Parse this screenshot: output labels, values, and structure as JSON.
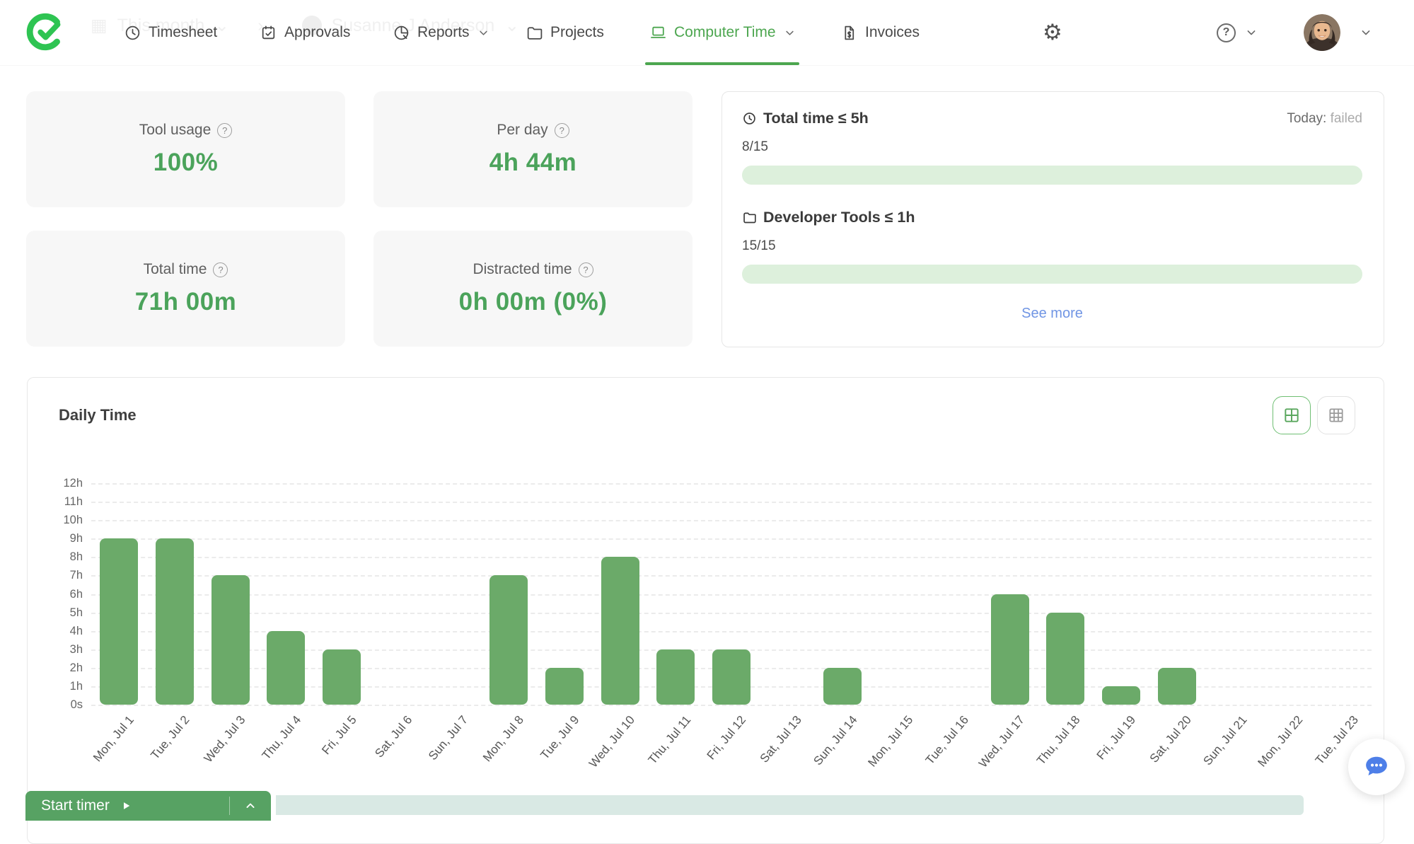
{
  "nav": {
    "logo_icon": "brand-check-logo-icon",
    "items": [
      {
        "label": "Timesheet",
        "icon": "clock-icon"
      },
      {
        "label": "Approvals",
        "icon": "calendar-check-icon"
      },
      {
        "label": "Reports",
        "icon": "pie-chart-icon",
        "chevron": true
      },
      {
        "label": "Projects",
        "icon": "folder-icon"
      },
      {
        "label": "Computer Time",
        "icon": "laptop-icon",
        "chevron": true,
        "active": true
      },
      {
        "label": "Invoices",
        "icon": "invoice-icon"
      }
    ],
    "gear_icon": "settings-gear-icon",
    "help_glyph": "?"
  },
  "ghost_header": {
    "period": "This month",
    "separator": "›",
    "user": "Susanne J Anderson"
  },
  "stats": [
    {
      "title": "Tool usage",
      "value": "100%",
      "help_glyph": "?"
    },
    {
      "title": "Per day",
      "value": "4h 44m",
      "help_glyph": "?"
    },
    {
      "title": "Total time",
      "value": "71h 00m",
      "help_glyph": "?"
    },
    {
      "title": "Distracted time",
      "value": "0h 00m (0%)",
      "help_glyph": "?"
    }
  ],
  "goals": {
    "items": [
      {
        "icon": "clock-icon",
        "title": "Total time ≤ 5h",
        "count": "8/15",
        "status_label": "Today:",
        "status_value": "failed",
        "progress_percent": 100
      },
      {
        "icon": "folder-icon",
        "title": "Developer Tools ≤ 1h",
        "count": "15/15",
        "progress_percent": 100
      }
    ],
    "see_more_label": "See more"
  },
  "chart_data": {
    "type": "bar",
    "title": "Daily Time",
    "categories": [
      "Mon, Jul 1",
      "Tue, Jul 2",
      "Wed, Jul 3",
      "Thu, Jul 4",
      "Fri, Jul 5",
      "Sat, Jul 6",
      "Sun, Jul 7",
      "Mon, Jul 8",
      "Tue, Jul 9",
      "Wed, Jul 10",
      "Thu, Jul 11",
      "Fri, Jul 12",
      "Sat, Jul 13",
      "Sun, Jul 14",
      "Mon, Jul 15",
      "Tue, Jul 16",
      "Wed, Jul 17",
      "Thu, Jul 18",
      "Fri, Jul 19",
      "Sat, Jul 20",
      "Sun, Jul 21",
      "Mon, Jul 22",
      "Tue, Jul 23"
    ],
    "values": [
      9,
      9,
      7,
      4,
      3,
      0,
      0,
      7,
      2,
      8,
      3,
      3,
      0,
      2,
      0,
      0,
      6,
      5,
      1,
      2,
      0,
      0,
      0
    ],
    "unit": "hours",
    "xlabel": "",
    "ylabel": "",
    "ylim": [
      0,
      12
    ],
    "ytick_labels": [
      "0s",
      "1h",
      "2h",
      "3h",
      "4h",
      "5h",
      "6h",
      "7h",
      "8h",
      "9h",
      "10h",
      "11h",
      "12h"
    ],
    "grid": "horizontal-dashed",
    "legend": "none",
    "bar_color": "#6BAA69"
  },
  "chart_controls": {
    "active_view_icon": "grid-2x2-icon",
    "inactive_view_icon": "grid-3x3-icon"
  },
  "timer": {
    "label": "Start timer",
    "play_icon": "play-icon",
    "collapse_icon": "chevron-up-icon"
  },
  "chat": {
    "icon": "chat-bubble-icon"
  },
  "colors": {
    "brand_green": "#2EC452",
    "accent_green": "#4CA64F",
    "value_green": "#4BA35B",
    "bar_green": "#6BAA69",
    "progress_green": "#DDF0DC",
    "link_blue": "#7095E4",
    "chat_blue": "#4E7FE8",
    "timer_green": "#57A263",
    "scroll_teal": "#D9E9E4"
  }
}
